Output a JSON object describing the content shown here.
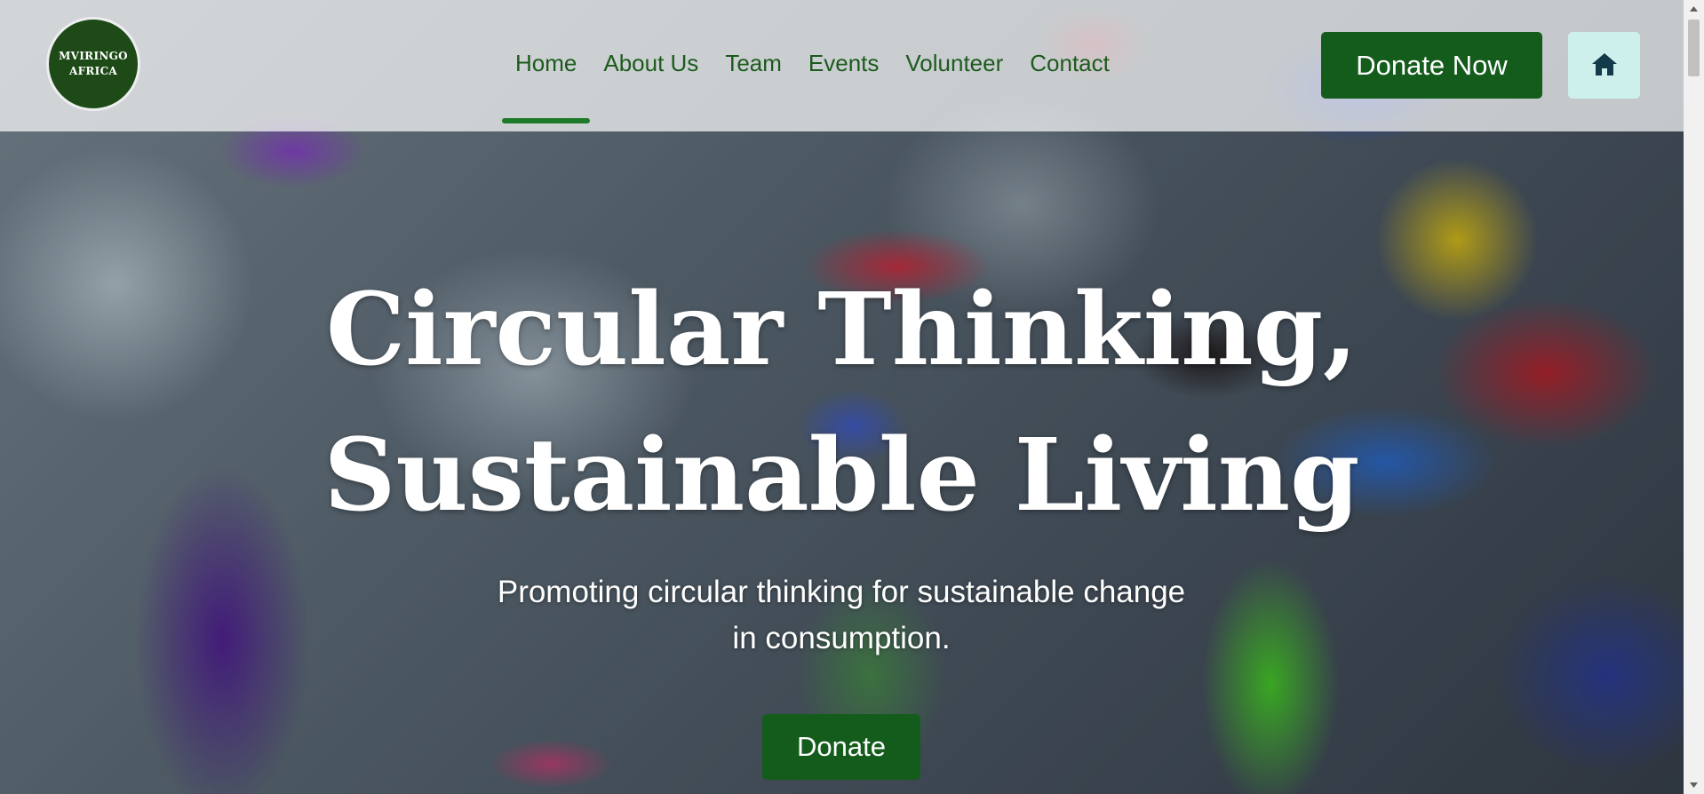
{
  "header": {
    "logo_text": "MVIRINGO AFRICA",
    "nav": [
      {
        "label": "Home",
        "active": true
      },
      {
        "label": "About Us",
        "active": false
      },
      {
        "label": "Team",
        "active": false
      },
      {
        "label": "Events",
        "active": false
      },
      {
        "label": "Volunteer",
        "active": false
      },
      {
        "label": "Contact",
        "active": false
      }
    ],
    "donate_now_label": "Donate Now",
    "home_icon": "home-icon"
  },
  "hero": {
    "title_line1": "Circular Thinking,",
    "title_line2": "Sustainable Living",
    "subtitle_line1": "Promoting circular thinking for sustainable change",
    "subtitle_line2": "in consumption.",
    "donate_label": "Donate",
    "background": "pile of plastic bottles and cans"
  },
  "colors": {
    "brand_green": "#145c1c",
    "nav_text": "#1c5b1c",
    "home_button_bg": "#cdf0ec",
    "home_icon": "#123a4a"
  }
}
